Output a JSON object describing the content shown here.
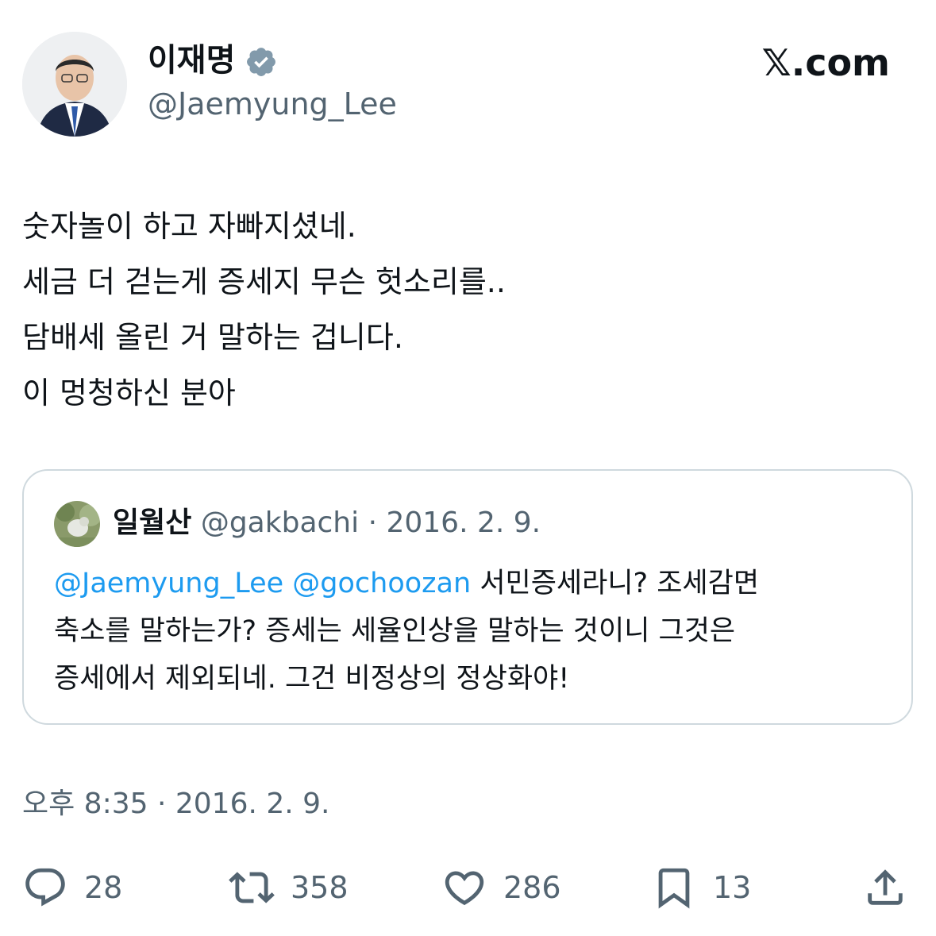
{
  "author": {
    "name": "이재명",
    "handle": "@Jaemyung_Lee",
    "verified_icon": "verified-badge-icon"
  },
  "site_logo": "𝕏.com",
  "tweet": {
    "lines": [
      "숫자놀이 하고 자빠지셨네.",
      "세금 더 걷는게 증세지 무슨 헛소리를..",
      "담배세 올린 거 말하는 겁니다.",
      "이 멍청하신 분아"
    ]
  },
  "quote": {
    "name": "일월산",
    "handle": "@gakbachi",
    "separator": " · ",
    "date": "2016. 2. 9.",
    "mentions": [
      "@Jaemyung_Lee",
      "@gochoozan"
    ],
    "line1_text": "서민증세라니? 조세감면",
    "line2": "축소를 말하는가? 증세는 세율인상을 말하는 것이니 그것은",
    "line3": "증세에서 제외되네. 그건 비정상의 정상화야!"
  },
  "timestamp": "오후 8:35 · 2016. 2. 9.",
  "actions": {
    "replies": "28",
    "retweets": "358",
    "likes": "286",
    "bookmarks": "13"
  },
  "colors": {
    "text": "#0f1419",
    "secondary": "#536471",
    "link": "#1d9bf0",
    "border": "#cfd9de",
    "verified": "#829aab"
  }
}
